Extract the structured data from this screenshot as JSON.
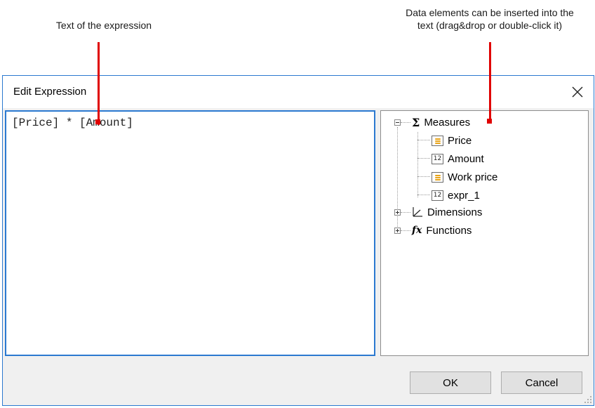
{
  "annotations": {
    "left": "Text of the expression",
    "right_line1": "Data elements can be inserted into the",
    "right_line2": "text (drag&drop or double-click it)",
    "marker_color": "#e00000"
  },
  "dialog": {
    "title": "Edit Expression",
    "accent_color": "#2b79d0"
  },
  "editor": {
    "text": "[Price] * [Amount]"
  },
  "tree": {
    "measures": {
      "label": "Measures",
      "icon": "sigma-icon",
      "icon_glyph": "Σ",
      "expanded": true,
      "children": [
        {
          "label": "Price",
          "icon": "coins-icon",
          "glyph": ""
        },
        {
          "label": "Amount",
          "icon": "number-icon",
          "glyph": "12"
        },
        {
          "label": "Work price",
          "icon": "coins-icon",
          "glyph": ""
        },
        {
          "label": "expr_1",
          "icon": "number-icon",
          "glyph": "12"
        }
      ]
    },
    "dimensions": {
      "label": "Dimensions",
      "icon": "axis-icon",
      "expanded": false
    },
    "functions": {
      "label": "Functions",
      "icon": "function-icon",
      "icon_glyph": "fx",
      "expanded": false
    }
  },
  "buttons": {
    "ok": "OK",
    "cancel": "Cancel"
  }
}
